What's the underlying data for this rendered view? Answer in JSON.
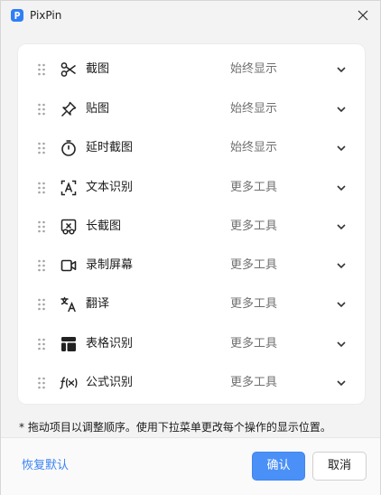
{
  "window": {
    "title": "PixPin",
    "accent_color": "#4a90f7"
  },
  "items": [
    {
      "label": "截图",
      "icon": "scissors-icon",
      "value": "始终显示"
    },
    {
      "label": "贴图",
      "icon": "pin-icon",
      "value": "始终显示"
    },
    {
      "label": "延时截图",
      "icon": "timer-icon",
      "value": "始终显示"
    },
    {
      "label": "文本识别",
      "icon": "text-recognition-icon",
      "value": "更多工具"
    },
    {
      "label": "长截图",
      "icon": "long-screenshot-icon",
      "value": "更多工具"
    },
    {
      "label": "录制屏幕",
      "icon": "video-camera-icon",
      "value": "更多工具"
    },
    {
      "label": "翻译",
      "icon": "translate-icon",
      "value": "更多工具"
    },
    {
      "label": "表格识别",
      "icon": "table-icon",
      "value": "更多工具"
    },
    {
      "label": "公式识别",
      "icon": "formula-icon",
      "value": "更多工具"
    }
  ],
  "hint": "* 拖动项目以调整顺序。使用下拉菜单更改每个操作的显示位置。",
  "footer": {
    "restore_label": "恢复默认",
    "ok_label": "确认",
    "cancel_label": "取消"
  }
}
